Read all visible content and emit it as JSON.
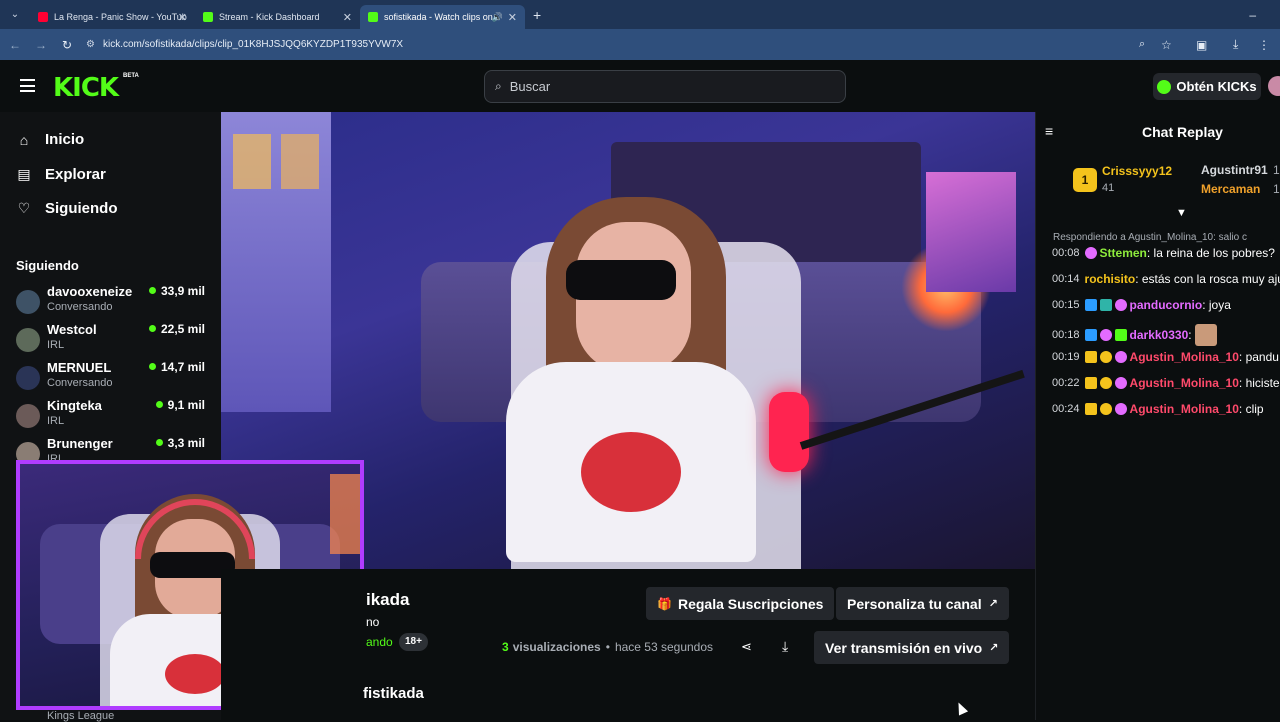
{
  "browser": {
    "tabs": [
      {
        "title": "La Renga - Panic Show - YouTub",
        "favicon": "youtube-icon",
        "color": "#ff0033"
      },
      {
        "title": "Stream - Kick Dashboard",
        "favicon": "kick-icon",
        "color": "#53fc18"
      },
      {
        "title": "sofistikada - Watch clips on",
        "favicon": "kick-icon",
        "color": "#53fc18"
      }
    ],
    "url": "kick.com/sofistikada/clips/clip_01K8HJSJQQ6KYZDP1T935YVW7X"
  },
  "header": {
    "logo": "KICK",
    "logo_badge": "BETA",
    "search_placeholder": "Buscar",
    "kicks_button": "Obtén KICKs"
  },
  "sidebar": {
    "nav": [
      {
        "label": "Inicio",
        "icon": "home-icon"
      },
      {
        "label": "Explorar",
        "icon": "compass-icon"
      },
      {
        "label": "Siguiendo",
        "icon": "heart-icon"
      }
    ],
    "following_title": "Siguiendo",
    "channels": [
      {
        "name": "davooxeneize",
        "category": "Conversando",
        "viewers": "33,9 mil"
      },
      {
        "name": "Westcol",
        "category": "IRL",
        "viewers": "22,5 mil"
      },
      {
        "name": "MERNUEL",
        "category": "Conversando",
        "viewers": "14,7 mil"
      },
      {
        "name": "Kingteka",
        "category": "IRL",
        "viewers": "9,1 mil"
      },
      {
        "name": "Brunenger",
        "category": "IRL",
        "viewers": "3,3 mil"
      }
    ],
    "bottom_channel_category": "Kings League"
  },
  "clip": {
    "channel_partial": "ikada",
    "subtitle_partial": "no",
    "category_partial": "ando",
    "age_badge": "18+",
    "views_count": "3",
    "views_label": "visualizaciones",
    "time_ago": "hace 53 segundos",
    "gift_button": "Regala Suscripciones",
    "customize_button": "Personaliza tu canal",
    "live_button": "Ver transmisión en vivo",
    "bottom_channel_partial": "fistikada"
  },
  "chat": {
    "title": "Chat Replay",
    "top_gifters": [
      {
        "rank": "1",
        "name": "Crisssyyy12",
        "count": "41",
        "color": "#f4c31c"
      },
      {
        "name": "Agustintr91",
        "suffix": "1",
        "color": "#d6d9dd"
      },
      {
        "name": "Mercaman",
        "suffix": "1",
        "color": "#f0a12b"
      }
    ],
    "reply_to": "Respondiendo a Agustin_Molina_10: salio c",
    "messages": [
      {
        "time": "00:08",
        "user": "Sttemen",
        "text": "la reina de los pobres?",
        "color": "#8eeb3c"
      },
      {
        "time": "00:14",
        "user": "rochisito",
        "text": "estás con la rosca muy aju",
        "color": "#f4c31c"
      },
      {
        "time": "00:15",
        "user": "panducornio",
        "text": "joya",
        "color": "#e36bff"
      },
      {
        "time": "00:18",
        "user": "darkk0330",
        "text": "",
        "color": "#e36bff"
      },
      {
        "time": "00:19",
        "user": "Agustin_Molina_10",
        "text": "pandu",
        "color": "#ff4a6b"
      },
      {
        "time": "00:22",
        "user": "Agustin_Molina_10",
        "text": "hiciste",
        "color": "#ff4a6b"
      },
      {
        "time": "00:24",
        "user": "Agustin_Molina_10",
        "text": "clip",
        "color": "#ff4a6b"
      }
    ]
  },
  "colors": {
    "accent": "#53fc18",
    "pip_border": "#b03cff"
  }
}
